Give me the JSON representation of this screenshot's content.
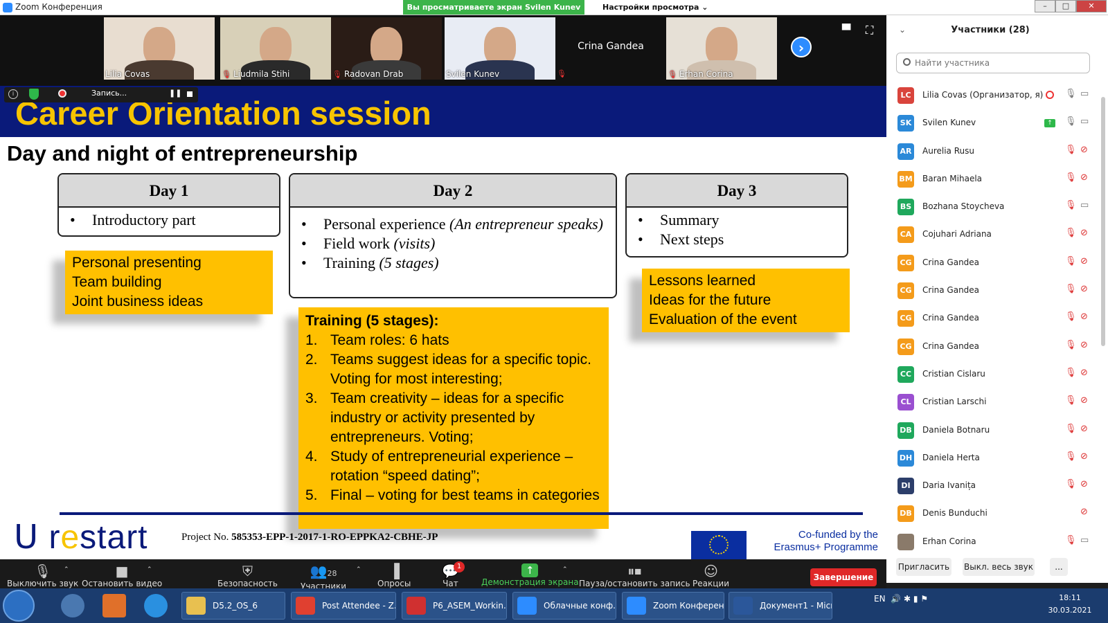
{
  "window": {
    "title": "Zoom Конференция",
    "share_banner": "Вы просматриваете экран Svilen Kunev",
    "view_settings": "Настройки просмотра ⌄"
  },
  "videos": [
    {
      "name": "Lilia Covas",
      "muted": false,
      "bg": "#e8ddd0",
      "shirt": "#4a3a30"
    },
    {
      "name": "Liudmila Stihi",
      "muted": true,
      "bg": "#d8d0b8",
      "shirt": "#2a2a2a"
    },
    {
      "name": "Radovan Drab",
      "muted": true,
      "bg": "#2a1c16",
      "shirt": "#3a3a3a"
    },
    {
      "name": "Svilen Kunev",
      "muted": false,
      "bg": "#e8ecf4",
      "shirt": "#2a3450"
    },
    {
      "name": "Crina Gandea",
      "muted": true
    },
    {
      "name": "Erhan Corina",
      "muted": true,
      "bg": "#e6e0d6",
      "shirt": "#cfbfae"
    }
  ],
  "recording": {
    "label": "Запись..."
  },
  "slide": {
    "title": "Career Orientation session",
    "subtitle": "Day and night of entrepreneurship",
    "day1": {
      "head": "Day 1",
      "items": [
        "Introductory part"
      ]
    },
    "day2": {
      "head": "Day 2",
      "items": [
        {
          "text": "Personal experience ",
          "em": "(An entrepreneur speaks)"
        },
        {
          "text": "Field work ",
          "em": "(visits)"
        },
        {
          "text": "Training ",
          "em": "(5 stages)"
        }
      ]
    },
    "day3": {
      "head": "Day 3",
      "items": [
        "Summary",
        "Next steps"
      ]
    },
    "box1": [
      "Personal presenting",
      "Team building",
      "Joint business ideas"
    ],
    "box3": [
      "Lessons learned",
      "Ideas for the future",
      "Evaluation of the event"
    ],
    "training": {
      "title": "Training (5 stages):",
      "items": [
        {
          "n": "1.",
          "t": "Team roles: 6 hats"
        },
        {
          "n": "2.",
          "t": "Teams suggest ideas for a specific topic. Voting for most interesting;"
        },
        {
          "n": "3.",
          "t": "Team creativity – ideas for a specific industry or activity presented by entrepreneurs. Voting;"
        },
        {
          "n": "4.",
          "t": "Study of entrepreneurial experience – rotation “speed dating”;"
        },
        {
          "n": "5.",
          "t": "Final – voting for best teams in categories"
        }
      ]
    },
    "logo": {
      "a": "ᑌ r",
      "e": "e",
      "b": "start"
    },
    "project_label": "Project No. ",
    "project_no": "585353-EPP-1-2017-1-RO-EPPKA2-CBHE-JP",
    "cofunded": "Co-funded by the Erasmus+ Programme"
  },
  "panel": {
    "title": "Участники (28)",
    "search_placeholder": "Найти участника",
    "invite": "Пригласить",
    "mute_all": "Выкл. весь звук",
    "more": "...",
    "participants": [
      {
        "initials": "LC",
        "name": "Lilia Covas (Организатор, я)",
        "color": "#d9443c",
        "mic": "on",
        "cam": "on",
        "rec": true
      },
      {
        "initials": "SK",
        "name": "Svilen Kunev",
        "color": "#2b89d8",
        "mic": "on",
        "cam": "on",
        "share": true
      },
      {
        "initials": "AR",
        "name": "Aurelia Rusu",
        "color": "#2b89d8",
        "mic": "off",
        "cam": "off"
      },
      {
        "initials": "BM",
        "name": "Baran Mihaela",
        "color": "#f49b1a",
        "mic": "off",
        "cam": "off"
      },
      {
        "initials": "BS",
        "name": "Bozhana Stoycheva",
        "color": "#1fa85c",
        "mic": "off",
        "cam": "on"
      },
      {
        "initials": "CA",
        "name": "Cojuhari Adriana",
        "color": "#f49b1a",
        "mic": "off",
        "cam": "off"
      },
      {
        "initials": "CG",
        "name": "Crina Gandea",
        "color": "#f49b1a",
        "mic": "off",
        "cam": "off"
      },
      {
        "initials": "CG",
        "name": "Crina Gandea",
        "color": "#f49b1a",
        "mic": "off",
        "cam": "off"
      },
      {
        "initials": "CG",
        "name": "Crina Gandea",
        "color": "#f49b1a",
        "mic": "off",
        "cam": "off"
      },
      {
        "initials": "CG",
        "name": "Crina Gandea",
        "color": "#f49b1a",
        "mic": "off",
        "cam": "off"
      },
      {
        "initials": "CC",
        "name": "Cristian Cislaru",
        "color": "#1fa85c",
        "mic": "off",
        "cam": "off"
      },
      {
        "initials": "CL",
        "name": "Cristian Larschi",
        "color": "#9a4fd0",
        "mic": "off",
        "cam": "off"
      },
      {
        "initials": "DB",
        "name": "Daniela Botnaru",
        "color": "#1fa85c",
        "mic": "off",
        "cam": "off"
      },
      {
        "initials": "DH",
        "name": "Daniela Herta",
        "color": "#2b89d8",
        "mic": "off",
        "cam": "off"
      },
      {
        "initials": "DI",
        "name": "Daria Ivanița",
        "color": "#2c3e6a",
        "mic": "off",
        "cam": "off"
      },
      {
        "initials": "DB",
        "name": "Denis Bunduchi",
        "color": "#f49b1a",
        "mic": "none",
        "cam": "off"
      },
      {
        "initials": "",
        "name": "Erhan Corina",
        "color": "#8a7a6a",
        "mic": "off",
        "cam": "on"
      }
    ]
  },
  "toolbar": {
    "mute": "Выключить звук",
    "video": "Остановить видео",
    "security": "Безопасность",
    "participants": "Участники",
    "participants_count": "28",
    "polls": "Опросы",
    "chat": "Чат",
    "chat_badge": "1",
    "share": "Демонстрация экрана",
    "pause_rec": "Пауза/остановить запись",
    "reactions": "Реакции",
    "end": "Завершение"
  },
  "taskbar": {
    "tasks": [
      "D5.2_OS_6",
      "Post Attendee - Z...",
      "P6_ASEM_Workin...",
      "Облачные конф...",
      "Zoom Конферен...",
      "Документ1 - Micr..."
    ],
    "task_colors": [
      "#e8c050",
      "#e04030",
      "#d03030",
      "#2d8cff",
      "#2d8cff",
      "#2b579a"
    ],
    "lang": "EN",
    "time": "18:11",
    "date": "30.03.2021"
  },
  "colors": {
    "slide_header": "#0a1a7a",
    "slide_title": "#f7c400",
    "box_yellow": "#ffc000",
    "zoom_blue": "#2d8cff",
    "share_green": "#3cb44a"
  }
}
